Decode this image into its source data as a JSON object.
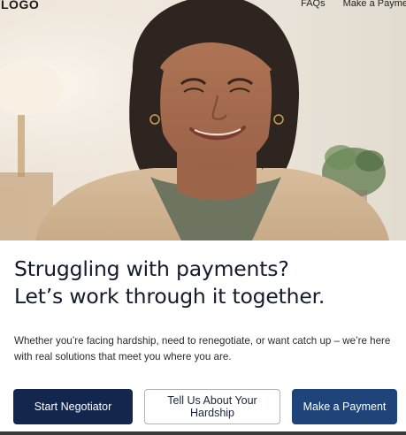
{
  "nav": {
    "logo": "LOGO",
    "links": [
      "FAQs",
      "Make a Payme"
    ]
  },
  "hero": {
    "image": "smiling-woman-portrait"
  },
  "content": {
    "headline_line1": "Struggling with payments?",
    "headline_line2": "Let’s work through it together.",
    "subtext": "Whether you’re facing hardship, need to renegotiate, or want catch up – we’re here with real solutions that meet you where you are."
  },
  "buttons": {
    "start_negotiator": "Start Negotiator",
    "tell_us_hardship": "Tell Us About Your Hardship",
    "make_payment": "Make a Payment"
  },
  "colors": {
    "primary_dark": "#13264d",
    "primary_blue": "#1f4479",
    "headline": "#141b2e"
  }
}
